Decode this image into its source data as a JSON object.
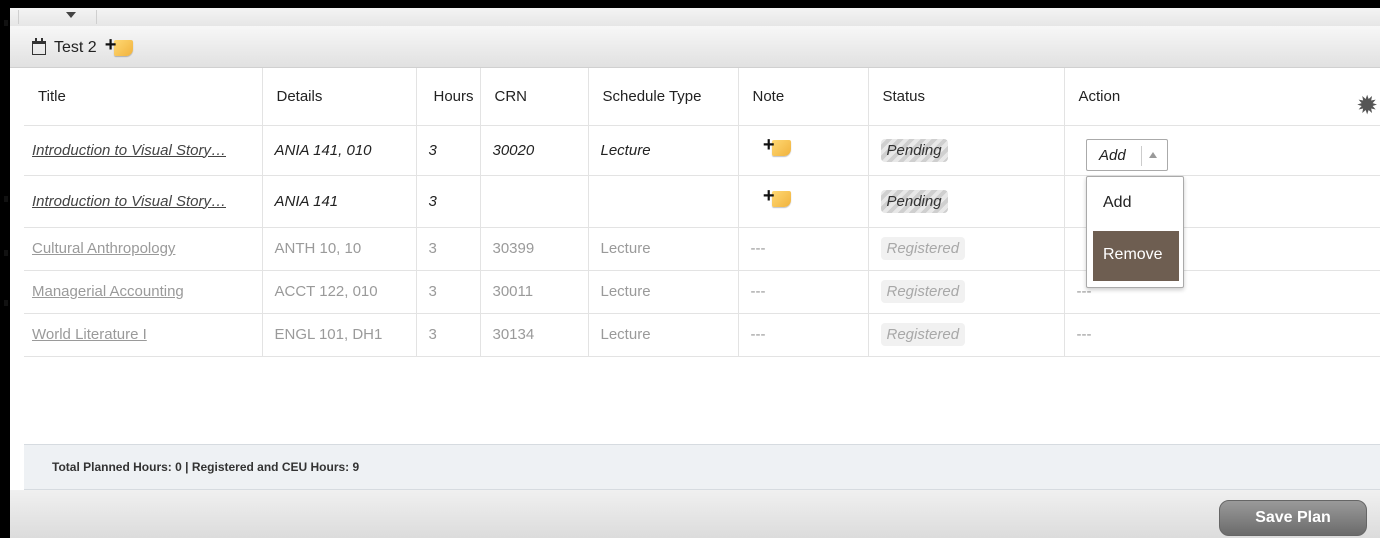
{
  "plan": {
    "title": "Test 2"
  },
  "table": {
    "headers": {
      "title": "Title",
      "details": "Details",
      "hours": "Hours",
      "crn": "CRN",
      "schedule_type": "Schedule Type",
      "note": "Note",
      "status": "Status",
      "action": "Action"
    },
    "rows": [
      {
        "title": "Introduction to Visual Story…",
        "details": "ANIA 141, 010",
        "hours": "3",
        "crn": "30020",
        "schedule_type": "Lecture",
        "note": "add-note-icon",
        "status": "Pending",
        "action": "Add"
      },
      {
        "title": "Introduction to Visual Story…",
        "details": "ANIA 141",
        "hours": "3",
        "crn": "",
        "schedule_type": "",
        "note": "add-note-icon",
        "status": "Pending",
        "action": ""
      },
      {
        "title": "Cultural Anthropology",
        "details": "ANTH 10, 10",
        "hours": "3",
        "crn": "30399",
        "schedule_type": "Lecture",
        "note": "---",
        "status": "Registered",
        "action": ""
      },
      {
        "title": "Managerial Accounting",
        "details": "ACCT 122, 010",
        "hours": "3",
        "crn": "30011",
        "schedule_type": "Lecture",
        "note": "---",
        "status": "Registered",
        "action": "---"
      },
      {
        "title": "World Literature I",
        "details": "ENGL 101, DH1",
        "hours": "3",
        "crn": "30134",
        "schedule_type": "Lecture",
        "note": "---",
        "status": "Registered",
        "action": "---"
      }
    ]
  },
  "action_dropdown": {
    "selected": "Add",
    "options": [
      "Add",
      "Remove"
    ],
    "highlighted": "Remove",
    "highlight_color": "#6e5e51"
  },
  "footer": {
    "summary": "Total Planned Hours: 0 | Registered and CEU Hours: 9"
  },
  "buttons": {
    "save": "Save Plan"
  },
  "icons": {
    "settings": "gear-icon",
    "plan": "calendar-icon",
    "note": "add-note-icon"
  }
}
